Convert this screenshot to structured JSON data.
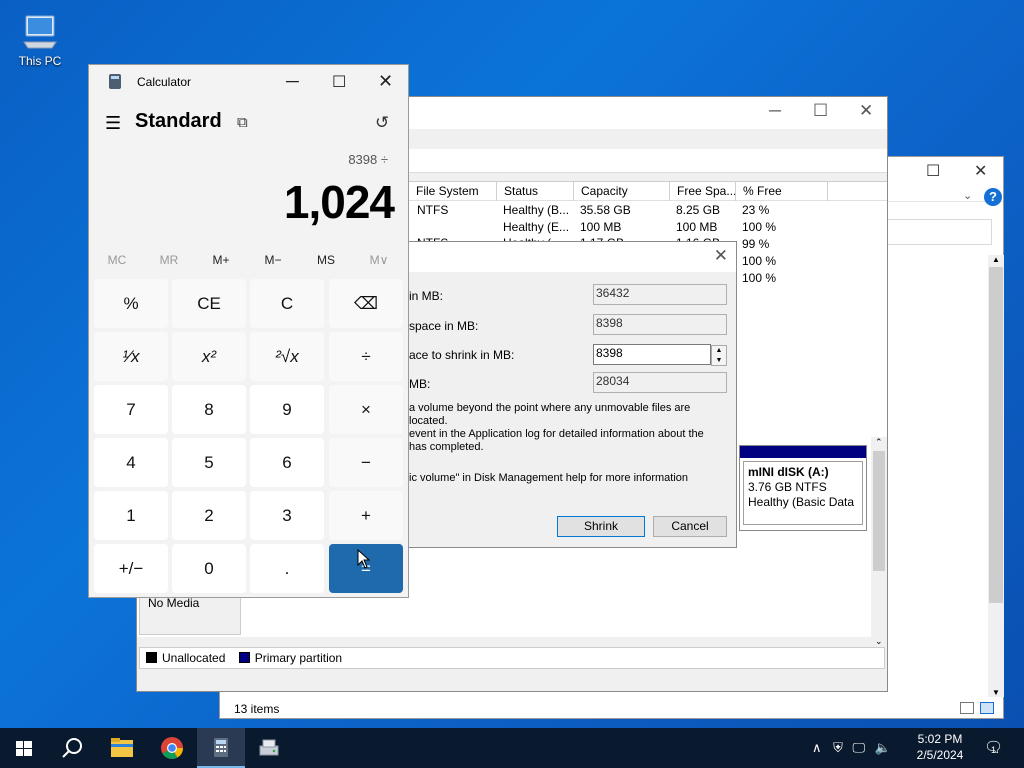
{
  "desktop": {
    "icon_label": "This PC"
  },
  "explorer": {
    "status": "13 items"
  },
  "disk_management": {
    "columns": [
      "File System",
      "Status",
      "Capacity",
      "Free Spa...",
      "% Free"
    ],
    "rows": [
      [
        "NTFS",
        "Healthy (B...",
        "35.58 GB",
        "8.25 GB",
        "23 %"
      ],
      [
        "",
        "Healthy (E...",
        "100 MB",
        "100 MB",
        "100 %"
      ],
      [
        "NTFS",
        "Healthy (...",
        "1.17 GB",
        "1.16 GB",
        "99 %"
      ],
      [
        "",
        "",
        "",
        "",
        "100 %"
      ],
      [
        "",
        "",
        "",
        "",
        "100 %"
      ]
    ],
    "disk_label": "No Media",
    "volume": {
      "name": "mINI dISK  (A:)",
      "size": "3.76 GB NTFS",
      "status": "Healthy (Basic Data P"
    },
    "legend": {
      "unallocated": "Unallocated",
      "primary": "Primary partition"
    },
    "colors": {
      "primary": "#000080",
      "unallocated": "#000000"
    }
  },
  "shrink_dialog": {
    "total_size_label": "in MB:",
    "total_size_value": "36432",
    "available_label": "space in MB:",
    "available_value": "8398",
    "amount_label": "ace to shrink in MB:",
    "amount_value": "8398",
    "after_label": "MB:",
    "after_value": "28034",
    "info_line1": " a volume beyond the point where any unmovable files are located.",
    "info_line2": "event in the Application log for detailed information about the",
    "info_line3": "has completed.",
    "help_text": "ic volume\" in Disk Management help for more information",
    "shrink_button": "Shrink",
    "cancel_button": "Cancel"
  },
  "calculator": {
    "title": "Calculator",
    "mode": "Standard",
    "expression": "8398 ÷",
    "display": "1,024",
    "memory": [
      "MC",
      "MR",
      "M+",
      "M−",
      "MS",
      "M∨"
    ],
    "keys": [
      [
        "%",
        "CE",
        "C",
        "⌫"
      ],
      [
        "¹⁄x",
        "x²",
        "²√x",
        "÷"
      ],
      [
        "7",
        "8",
        "9",
        "×"
      ],
      [
        "4",
        "5",
        "6",
        "−"
      ],
      [
        "1",
        "2",
        "3",
        "+"
      ],
      [
        "+/−",
        "0",
        ".",
        "="
      ]
    ],
    "accent": "#1e6aad"
  },
  "taskbar": {
    "time": "5:02 PM",
    "date": "2/5/2024",
    "notification_count": "1"
  }
}
